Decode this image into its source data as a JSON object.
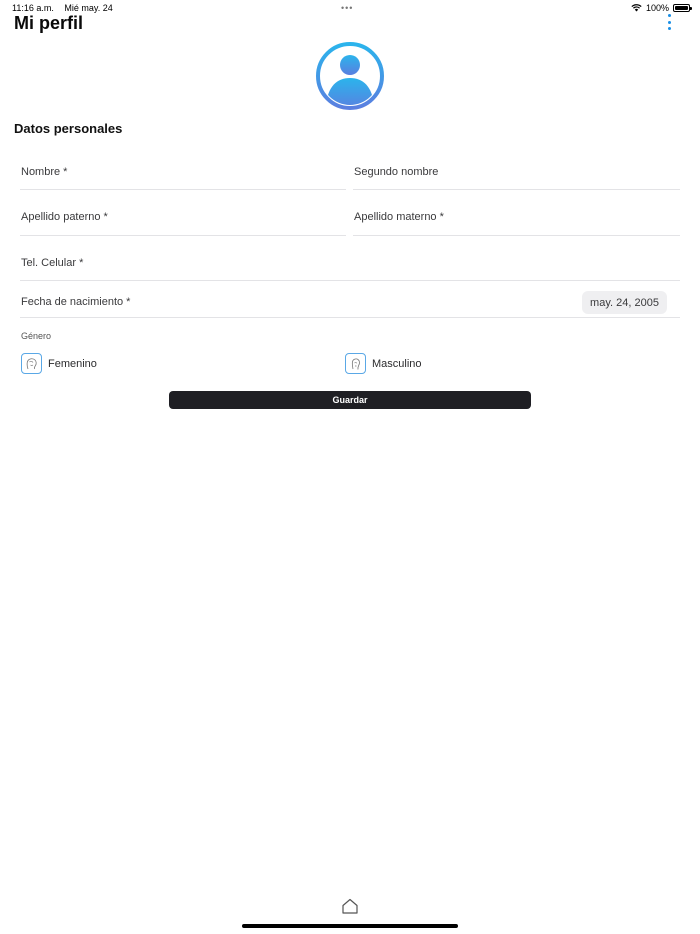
{
  "status_bar": {
    "time": "11:16 a.m.",
    "date": "Mié may. 24",
    "dots": "•••",
    "battery": "100%"
  },
  "header": {
    "title": "Mi perfil"
  },
  "section": {
    "title": "Datos personales"
  },
  "fields": {
    "nombre": "Nombre *",
    "segundo_nombre": "Segundo nombre",
    "apellido_paterno": "Apellido paterno *",
    "apellido_materno": "Apellido materno *",
    "tel_celular": "Tel. Celular *",
    "fecha_nacimiento": "Fecha de nacimiento *"
  },
  "birth_date": "may. 24, 2005",
  "gender": {
    "label": "Género",
    "female": "Femenino",
    "male": "Masculino"
  },
  "save_label": "Guardar",
  "colors": {
    "accent": "#1a8fe6",
    "avatar_gradient_top": "#2bb4ec",
    "avatar_gradient_bottom": "#5a7fe0",
    "button_bg": "#1f1f24"
  }
}
